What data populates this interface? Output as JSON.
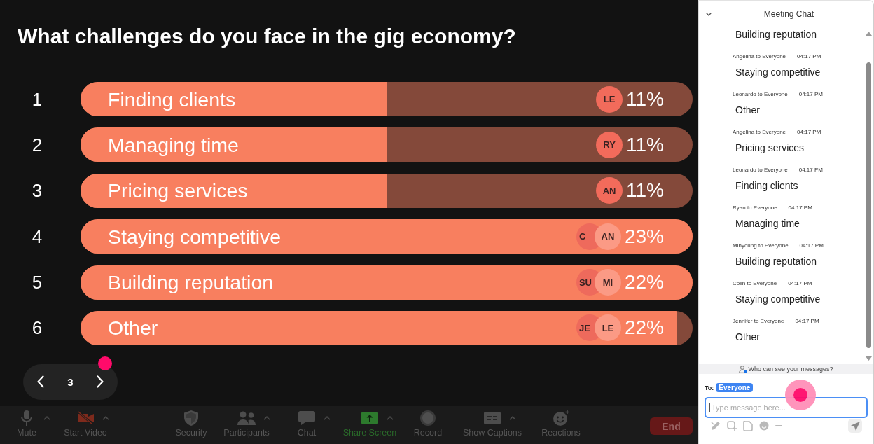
{
  "poll": {
    "question": "What challenges do you face in the gig economy?",
    "options": [
      {
        "number": "1",
        "label": "Finding clients",
        "level": 0.5,
        "percent": "11%",
        "avatars": [
          {
            "initials": "LE",
            "color": "#f26b5b"
          }
        ]
      },
      {
        "number": "2",
        "label": "Managing time",
        "level": 0.5,
        "percent": "11%",
        "avatars": [
          {
            "initials": "RY",
            "color": "#f26b5b"
          }
        ]
      },
      {
        "number": "3",
        "label": "Pricing services",
        "level": 0.5,
        "percent": "11%",
        "avatars": [
          {
            "initials": "AN",
            "color": "#f26b5b"
          }
        ]
      },
      {
        "number": "4",
        "label": "Staying competitive",
        "level": 1,
        "percent": "23%",
        "avatars": [
          {
            "initials": "C",
            "color": "#ee6a5c"
          },
          {
            "initials": "AN",
            "color": "#fb9a85"
          }
        ]
      },
      {
        "number": "5",
        "label": "Building reputation",
        "level": 1,
        "percent": "22%",
        "avatars": [
          {
            "initials": "SU",
            "color": "#ee6a5c"
          },
          {
            "initials": "MI",
            "color": "#fb9a85"
          }
        ]
      },
      {
        "number": "6",
        "label": "Other",
        "level": 0.974,
        "percent": "22%",
        "avatars": [
          {
            "initials": "JE",
            "color": "#ee6a5c"
          },
          {
            "initials": "LE",
            "color": "#fb9a85"
          }
        ]
      }
    ]
  },
  "pagination": {
    "page": "3"
  },
  "toolbar": {
    "items": [
      {
        "label": "Mute",
        "kind": "microphone",
        "has_menu": true
      },
      {
        "label": "Start Video",
        "kind": "video-off",
        "has_menu": true
      },
      {
        "label": "Security",
        "kind": "shield",
        "has_menu": false
      },
      {
        "label": "Participants",
        "kind": "participants",
        "has_menu": true
      },
      {
        "label": "Chat",
        "kind": "chat",
        "has_menu": true
      },
      {
        "label": "Share Screen",
        "kind": "share",
        "has_menu": true
      },
      {
        "label": "Record",
        "kind": "record",
        "has_menu": false
      },
      {
        "label": "Show Captions",
        "kind": "captions",
        "has_menu": true
      },
      {
        "label": "Reactions",
        "kind": "reactions",
        "has_menu": false
      }
    ],
    "end_button": {
      "label": "End"
    }
  },
  "chat": {
    "title": "Meeting Chat",
    "messages": [
      {
        "text": "Building reputation"
      },
      {
        "sender": "Angelina to Everyone",
        "time": "04:17 PM",
        "text": "Staying competitive"
      },
      {
        "sender": "Leonardo to Everyone",
        "time": "04:17 PM",
        "text": "Other"
      },
      {
        "sender": "Angelina to Everyone",
        "time": "04:17 PM",
        "text": "Pricing services"
      },
      {
        "sender": "Leonardo to Everyone",
        "time": "04:17 PM",
        "text": "Finding clients"
      },
      {
        "sender": "Ryan to Everyone",
        "time": "04:17 PM",
        "text": "Managing time"
      },
      {
        "sender": "Minyoung to Everyone",
        "time": "04:17 PM",
        "text": "Building reputation"
      },
      {
        "sender": "Colin to Everyone",
        "time": "04:17 PM",
        "text": "Staying competitive"
      },
      {
        "sender": "Jennifer to Everyone",
        "time": "04:17 PM",
        "text": "Other"
      }
    ],
    "privacy_note": "Who can see your messages?",
    "recipient_label": "To:",
    "recipient": "Everyone",
    "input": {
      "placeholder": "Type message here...",
      "focused": true
    }
  }
}
